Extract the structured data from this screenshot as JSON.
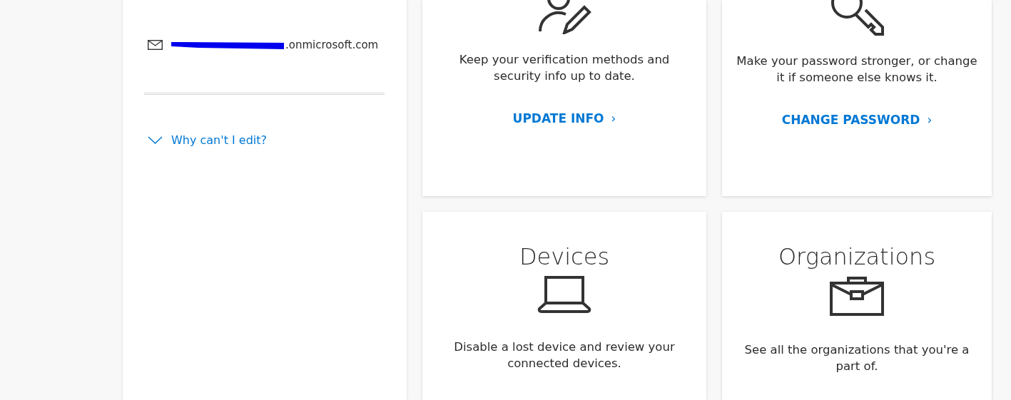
{
  "profile": {
    "email": ".onmicrosoft.com",
    "why_link": "Why can't I edit?"
  },
  "cards": [
    {
      "kind": "security",
      "description": "Keep your verification methods and security info up to date.",
      "action": "UPDATE INFO",
      "chevron": "›"
    },
    {
      "kind": "password",
      "description": "Make your password stronger, or change it if someone else knows it.",
      "action": "CHANGE PASSWORD",
      "chevron": "›"
    },
    {
      "kind": "devices",
      "title": "Devices",
      "description": "Disable a lost device and review your connected devices."
    },
    {
      "kind": "organizations",
      "title": "Organizations",
      "description": "See all the organizations that you're a part of."
    }
  ]
}
